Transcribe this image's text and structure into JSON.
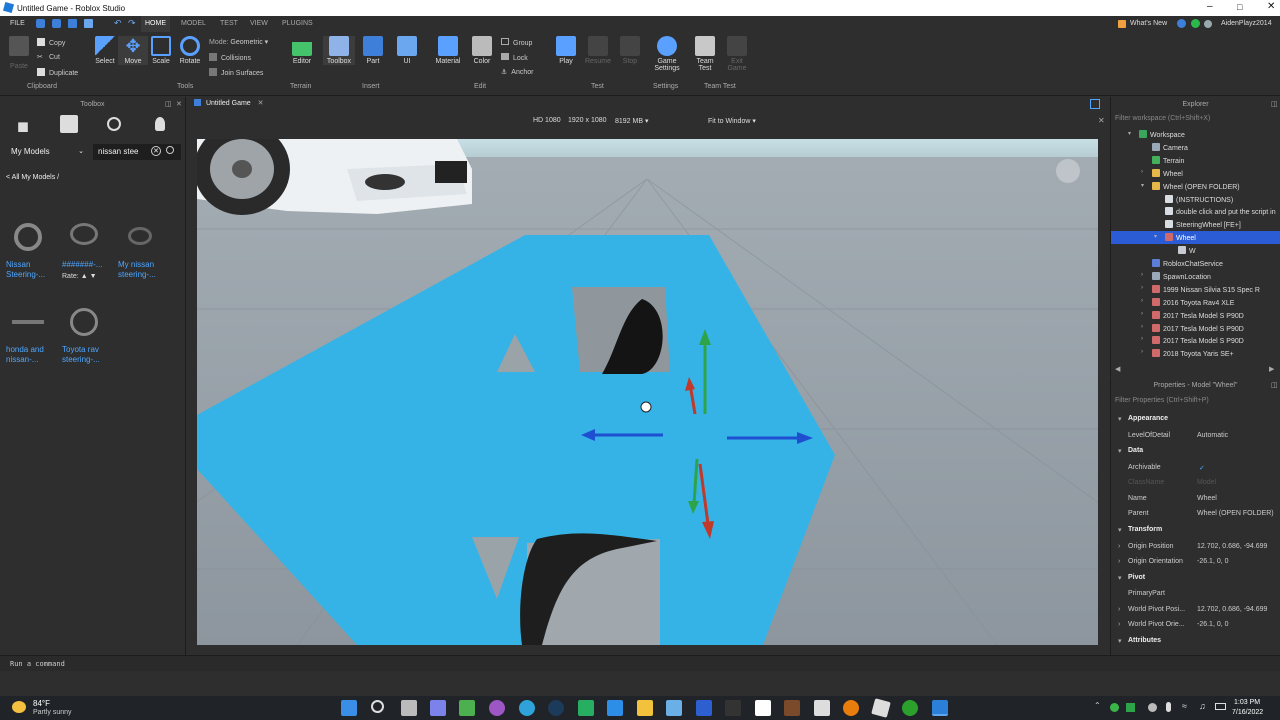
{
  "window": {
    "title": "Untitled Game - Roblox Studio"
  },
  "menu": {
    "file": "FILE",
    "tabs": [
      "HOME",
      "MODEL",
      "TEST",
      "VIEW",
      "PLUGINS"
    ],
    "whats_new": "What's New",
    "username": "AidenPlayz2014"
  },
  "ribbon": {
    "clipboard": {
      "paste": "Paste",
      "copy": "Copy",
      "cut": "Cut",
      "duplicate": "Duplicate",
      "group": "Clipboard"
    },
    "tools": {
      "select": "Select",
      "move": "Move",
      "scale": "Scale",
      "rotate": "Rotate",
      "mode_label": "Mode:",
      "mode_value": "Geometric",
      "collisions": "Collisions",
      "join_surfaces": "Join Surfaces",
      "group": "Tools"
    },
    "terrain": {
      "editor": "Editor",
      "group": "Terrain"
    },
    "insert": {
      "toolbox": "Toolbox",
      "part": "Part",
      "ui": "UI",
      "group": "Insert"
    },
    "edit": {
      "material": "Material",
      "color": "Color",
      "group_btn": "Group",
      "lock": "Lock",
      "anchor": "Anchor",
      "group": "Edit"
    },
    "test": {
      "play": "Play",
      "resume": "Resume",
      "stop": "Stop",
      "group": "Test"
    },
    "settings": {
      "game_settings": "Game Settings",
      "group": "Settings"
    },
    "team_test": {
      "team_test": "Team Test",
      "exit_game": "Exit Game",
      "group": "Team Test"
    }
  },
  "toolbox": {
    "title": "Toolbox",
    "category": "My Models",
    "search_value": "nissan stee",
    "breadcrumb": "< All My Models /",
    "rate_label": "Rate:",
    "models": [
      {
        "name": "Nissan Steering-..."
      },
      {
        "name": "#######-..."
      },
      {
        "name": "My nissan steering-..."
      },
      {
        "name": "honda and nissan-..."
      },
      {
        "name": "Toyota rav steering-..."
      }
    ]
  },
  "viewport": {
    "tab_title": "Untitled Game",
    "resolution_label": "HD 1080",
    "resolution": "1920 x 1080",
    "memory": "8192 MB",
    "fit": "Fit to Window"
  },
  "explorer": {
    "title": "Explorer",
    "filter_placeholder": "Filter workspace (Ctrl+Shift+X)",
    "items": [
      {
        "label": "Workspace",
        "depth": 0,
        "icon": "#3aa55d",
        "arrow": "v"
      },
      {
        "label": "Camera",
        "depth": 1,
        "icon": "#9aa9b8",
        "arrow": ""
      },
      {
        "label": "Terrain",
        "depth": 1,
        "icon": "#43b05c",
        "arrow": ""
      },
      {
        "label": "Wheel",
        "depth": 1,
        "icon": "#e6b84a",
        "arrow": ">"
      },
      {
        "label": "Wheel (OPEN FOLDER)",
        "depth": 1,
        "icon": "#e6b84a",
        "arrow": "v"
      },
      {
        "label": "(INSTRUCTIONS)",
        "depth": 2,
        "icon": "#d8dde3",
        "arrow": ""
      },
      {
        "label": "double click and put the script in",
        "depth": 2,
        "icon": "#d8dde3",
        "arrow": ""
      },
      {
        "label": "SteeringWheel [FE+]",
        "depth": 2,
        "icon": "#d8dde3",
        "arrow": ""
      },
      {
        "label": "Wheel",
        "depth": 2,
        "icon": "#d06a6a",
        "arrow": "v",
        "selected": true
      },
      {
        "label": "W",
        "depth": 3,
        "icon": "#c8ccd2",
        "arrow": ""
      },
      {
        "label": "RobloxChatService",
        "depth": 1,
        "icon": "#5b7fd6",
        "arrow": ""
      },
      {
        "label": "SpawnLocation",
        "depth": 1,
        "icon": "#9aa9b8",
        "arrow": ">"
      },
      {
        "label": "1999 Nissan Silvia S15 Spec R",
        "depth": 1,
        "icon": "#d06a6a",
        "arrow": ">"
      },
      {
        "label": "2016 Toyota Rav4 XLE",
        "depth": 1,
        "icon": "#d06a6a",
        "arrow": ">"
      },
      {
        "label": "2017 Tesla Model S P90D",
        "depth": 1,
        "icon": "#d06a6a",
        "arrow": ">"
      },
      {
        "label": "2017 Tesla Model S P90D",
        "depth": 1,
        "icon": "#d06a6a",
        "arrow": ">"
      },
      {
        "label": "2017 Tesla Model S P90D",
        "depth": 1,
        "icon": "#d06a6a",
        "arrow": ">"
      },
      {
        "label": "2018 Toyota Yaris SE+",
        "depth": 1,
        "icon": "#d06a6a",
        "arrow": ">"
      }
    ]
  },
  "properties": {
    "title": "Properties - Model \"Wheel\"",
    "filter_placeholder": "Filter Properties (Ctrl+Shift+P)",
    "rows": [
      {
        "kind": "head",
        "label": "Appearance"
      },
      {
        "kind": "row",
        "key": "LevelOfDetail",
        "value": "Automatic"
      },
      {
        "kind": "head",
        "label": "Data"
      },
      {
        "kind": "row",
        "key": "Archivable",
        "value": "✓"
      },
      {
        "kind": "row",
        "key": "ClassName",
        "value": "Model",
        "dim": true
      },
      {
        "kind": "row",
        "key": "Name",
        "value": "Wheel"
      },
      {
        "kind": "row",
        "key": "Parent",
        "value": "Wheel (OPEN FOLDER)"
      },
      {
        "kind": "head",
        "label": "Transform"
      },
      {
        "kind": "row",
        "key": "Origin Position",
        "value": "12.702, 0.686, -94.699",
        "arrow": true
      },
      {
        "kind": "row",
        "key": "Origin Orientation",
        "value": "-26.1, 0, 0",
        "arrow": true
      },
      {
        "kind": "head",
        "label": "Pivot"
      },
      {
        "kind": "row",
        "key": "PrimaryPart",
        "value": ""
      },
      {
        "kind": "row",
        "key": "World Pivot Posi...",
        "value": "12.702, 0.686, -94.699",
        "arrow": true
      },
      {
        "kind": "row",
        "key": "World Pivot Orie...",
        "value": "-26.1, 0, 0",
        "arrow": true
      },
      {
        "kind": "head",
        "label": "Attributes"
      }
    ]
  },
  "command": {
    "placeholder": "Run a command"
  },
  "taskbar": {
    "weather_temp": "84°F",
    "weather_desc": "Partly sunny",
    "time": "1:03 PM",
    "date": "7/16/2022"
  },
  "colors": {
    "accent": "#2b5cd6",
    "selection_blue": "#35b3e6",
    "link": "#4ea6ff"
  }
}
